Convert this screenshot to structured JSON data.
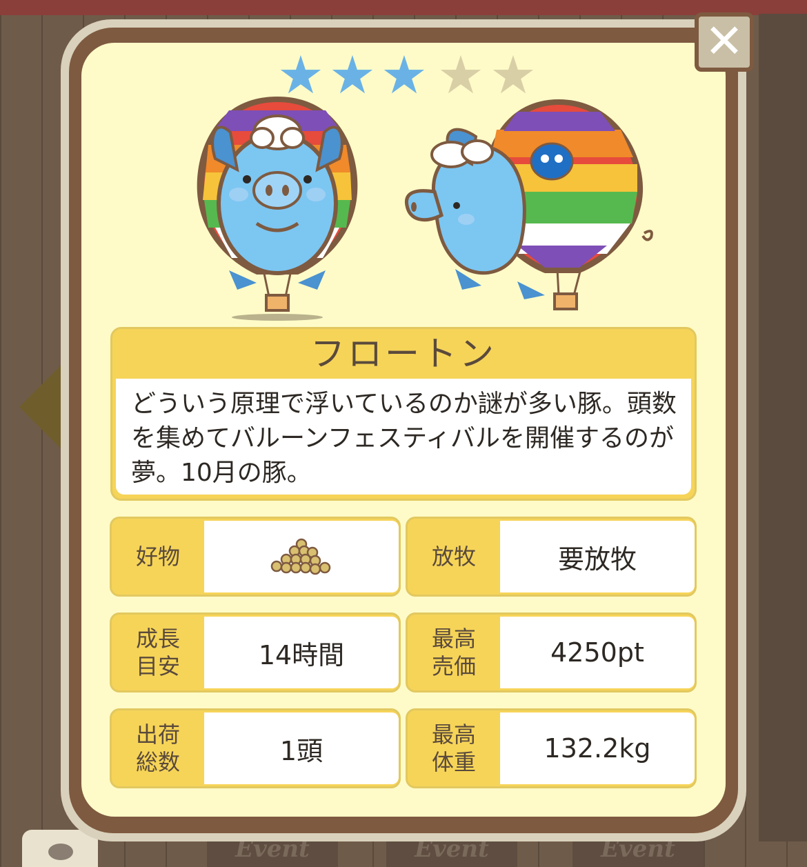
{
  "rating": {
    "filled": 3,
    "total": 5
  },
  "pig": {
    "name": "フロートン",
    "description": "どういう原理で浮いているのか謎が多い豚。頭数を集めてバルーンフェスティバルを開催するのが夢。10月の豚。"
  },
  "stats": {
    "favorite_food": {
      "label": "好物",
      "icon": "beans-pile-icon"
    },
    "grazing": {
      "label": "放牧",
      "value": "要放牧"
    },
    "growth_time": {
      "label": "成長\n目安",
      "value": "14時間"
    },
    "max_price": {
      "label": "最高\n売価",
      "value": "4250pt"
    },
    "shipped_total": {
      "label": "出荷\n総数",
      "value": "1頭"
    },
    "max_weight": {
      "label": "最高\n体重",
      "value": "132.2kg"
    }
  },
  "close": {
    "glyph": "✕"
  },
  "bottom_tabs": [
    "Event",
    "Event",
    "Event"
  ],
  "colors": {
    "card_bg": "#fefbc8",
    "frame": "#7e5a40",
    "label_yellow": "#f6d458",
    "star_filled": "#6ab2e6",
    "star_empty": "#d9cfa6",
    "pig_blue": "#7cc6f2"
  }
}
